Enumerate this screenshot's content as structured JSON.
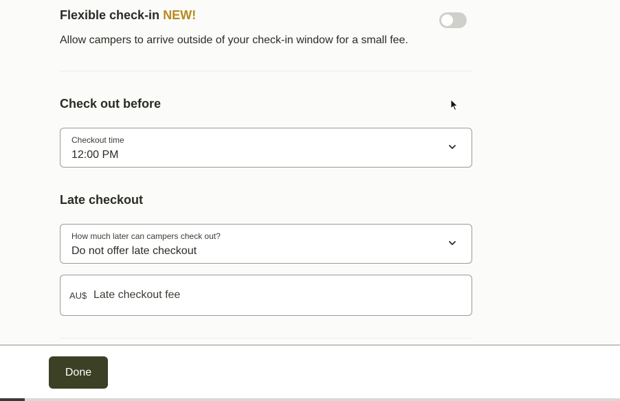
{
  "flexible_checkin": {
    "title": "Flexible check-in",
    "badge": "NEW!",
    "description": "Allow campers to arrive outside of your check-in window for a small fee.",
    "enabled": false
  },
  "checkout": {
    "heading": "Check out before",
    "field_label": "Checkout time",
    "field_value": "12:00 PM"
  },
  "late_checkout": {
    "heading": "Late checkout",
    "field_label": "How much later can campers check out?",
    "field_value": "Do not offer late checkout",
    "currency": "AU$",
    "fee_placeholder": "Late checkout fee"
  },
  "footer": {
    "done_label": "Done"
  },
  "progress": {
    "fraction": 0.04
  },
  "icons": {
    "dropdown": "chevron-down-icon",
    "cursor": "mouse-pointer-icon"
  },
  "colors": {
    "new_badge": "#b88a1c",
    "done_button": "#3c4025",
    "toggle_off": "#cfcfcc"
  }
}
